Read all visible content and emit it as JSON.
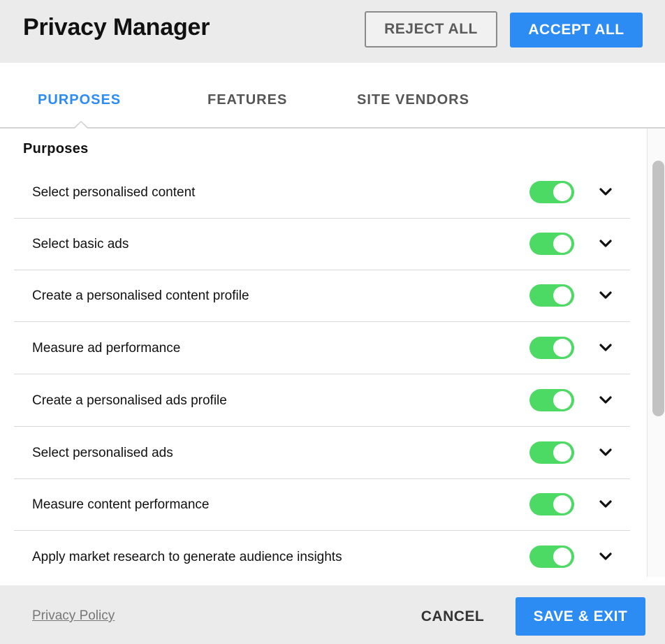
{
  "header": {
    "title": "Privacy Manager",
    "reject_label": "REJECT ALL",
    "accept_label": "ACCEPT ALL"
  },
  "tabs": [
    {
      "label": "PURPOSES",
      "active": true
    },
    {
      "label": "FEATURES",
      "active": false
    },
    {
      "label": "SITE VENDORS",
      "active": false
    }
  ],
  "section": {
    "title": "Purposes",
    "items": [
      {
        "label": "Select personalised content",
        "enabled": true
      },
      {
        "label": "Select basic ads",
        "enabled": true
      },
      {
        "label": "Create a personalised content profile",
        "enabled": true
      },
      {
        "label": "Measure ad performance",
        "enabled": true
      },
      {
        "label": "Create a personalised ads profile",
        "enabled": true
      },
      {
        "label": "Select personalised ads",
        "enabled": true
      },
      {
        "label": "Measure content performance",
        "enabled": true
      },
      {
        "label": "Apply market research to generate audience insights",
        "enabled": true
      }
    ]
  },
  "footer": {
    "privacy_link": "Privacy Policy",
    "cancel_label": "CANCEL",
    "save_label": "SAVE & EXIT"
  },
  "colors": {
    "accent": "#2c8cf4",
    "toggle_on": "#4cd964",
    "header_bg": "#ebebeb"
  },
  "icons": {
    "row_expand": "chevron-down-icon"
  }
}
